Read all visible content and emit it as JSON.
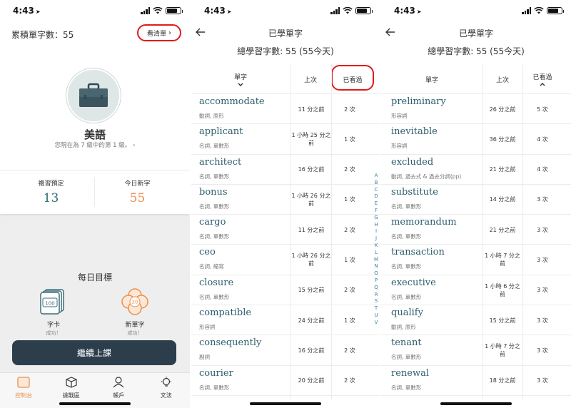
{
  "status_time": "4:43",
  "screen1": {
    "cumulative_words": "累積單字數：55",
    "view_list": "看清單",
    "language": "美語",
    "level_text": "您現在為 7 級中的第 1 級。",
    "review_label": "複習預定",
    "review_value": "13",
    "new_today_label": "今日新字",
    "new_today_value": "55",
    "daily_goal": "每日目標",
    "goal_cards": {
      "name": "字卡",
      "status": "成功！",
      "icon_number": "100"
    },
    "goal_new": {
      "name": "新單字",
      "status": "成功！",
      "icon_number": "20"
    },
    "continue": "繼續上課",
    "tabs": [
      "控制台",
      "挑戰區",
      "帳戶",
      "文法"
    ],
    "colors": {
      "accent": "#e8914e",
      "review": "#2d6b73",
      "button": "#2c3e4c"
    }
  },
  "list_common": {
    "title": "已學單字",
    "total": "總學習字數: 55 (55今天)",
    "col_word": "單字",
    "col_last": "上次",
    "col_seen": "已看過",
    "alphabet": "A B C D E F G H I J K L M N O P Q R S T U V"
  },
  "screen2_rows": [
    {
      "word": "accommodate",
      "pos": "動詞, 原形",
      "last": "11 分之前",
      "count": "2 次"
    },
    {
      "word": "applicant",
      "pos": "名詞, 單數形",
      "last": "1 小時 25 分之前",
      "count": "1 次"
    },
    {
      "word": "architect",
      "pos": "名詞, 單數形",
      "last": "16 分之前",
      "count": "2 次"
    },
    {
      "word": "bonus",
      "pos": "名詞, 單數形",
      "last": "1 小時 26 分之前",
      "count": "1 次"
    },
    {
      "word": "cargo",
      "pos": "名詞, 單數形",
      "last": "11 分之前",
      "count": "2 次"
    },
    {
      "word": "ceo",
      "pos": "名詞, 縮寫",
      "last": "1 小時 26 分之前",
      "count": "1 次"
    },
    {
      "word": "closure",
      "pos": "名詞, 單數形",
      "last": "15 分之前",
      "count": "2 次"
    },
    {
      "word": "compatible",
      "pos": "形容詞",
      "last": "24 分之前",
      "count": "1 次"
    },
    {
      "word": "consequently",
      "pos": "副詞",
      "last": "16 分之前",
      "count": "2 次"
    },
    {
      "word": "courier",
      "pos": "名詞, 單數形",
      "last": "20 分之前",
      "count": "2 次"
    }
  ],
  "screen3_rows": [
    {
      "word": "preliminary",
      "pos": "形容詞",
      "last": "26 分之前",
      "count": "5 次"
    },
    {
      "word": "inevitable",
      "pos": "形容詞",
      "last": "36 分之前",
      "count": "4 次"
    },
    {
      "word": "excluded",
      "pos": "動詞, 過去式 & 過去分詞(pp)",
      "last": "21 分之前",
      "count": "4 次"
    },
    {
      "word": "substitute",
      "pos": "名詞, 單數形",
      "last": "14 分之前",
      "count": "3 次"
    },
    {
      "word": "memorandum",
      "pos": "名詞, 單數形",
      "last": "21 分之前",
      "count": "3 次"
    },
    {
      "word": "transaction",
      "pos": "名詞, 單數形",
      "last": "1 小時 7 分之前",
      "count": "3 次"
    },
    {
      "word": "executive",
      "pos": "名詞, 單數形",
      "last": "1 小時 6 分之前",
      "count": "3 次"
    },
    {
      "word": "qualify",
      "pos": "動詞, 原形",
      "last": "15 分之前",
      "count": "3 次"
    },
    {
      "word": "tenant",
      "pos": "名詞, 單數形",
      "last": "1 小時 7 分之前",
      "count": "3 次"
    },
    {
      "word": "renewal",
      "pos": "名詞, 單數形",
      "last": "18 分之前",
      "count": "3 次"
    }
  ]
}
